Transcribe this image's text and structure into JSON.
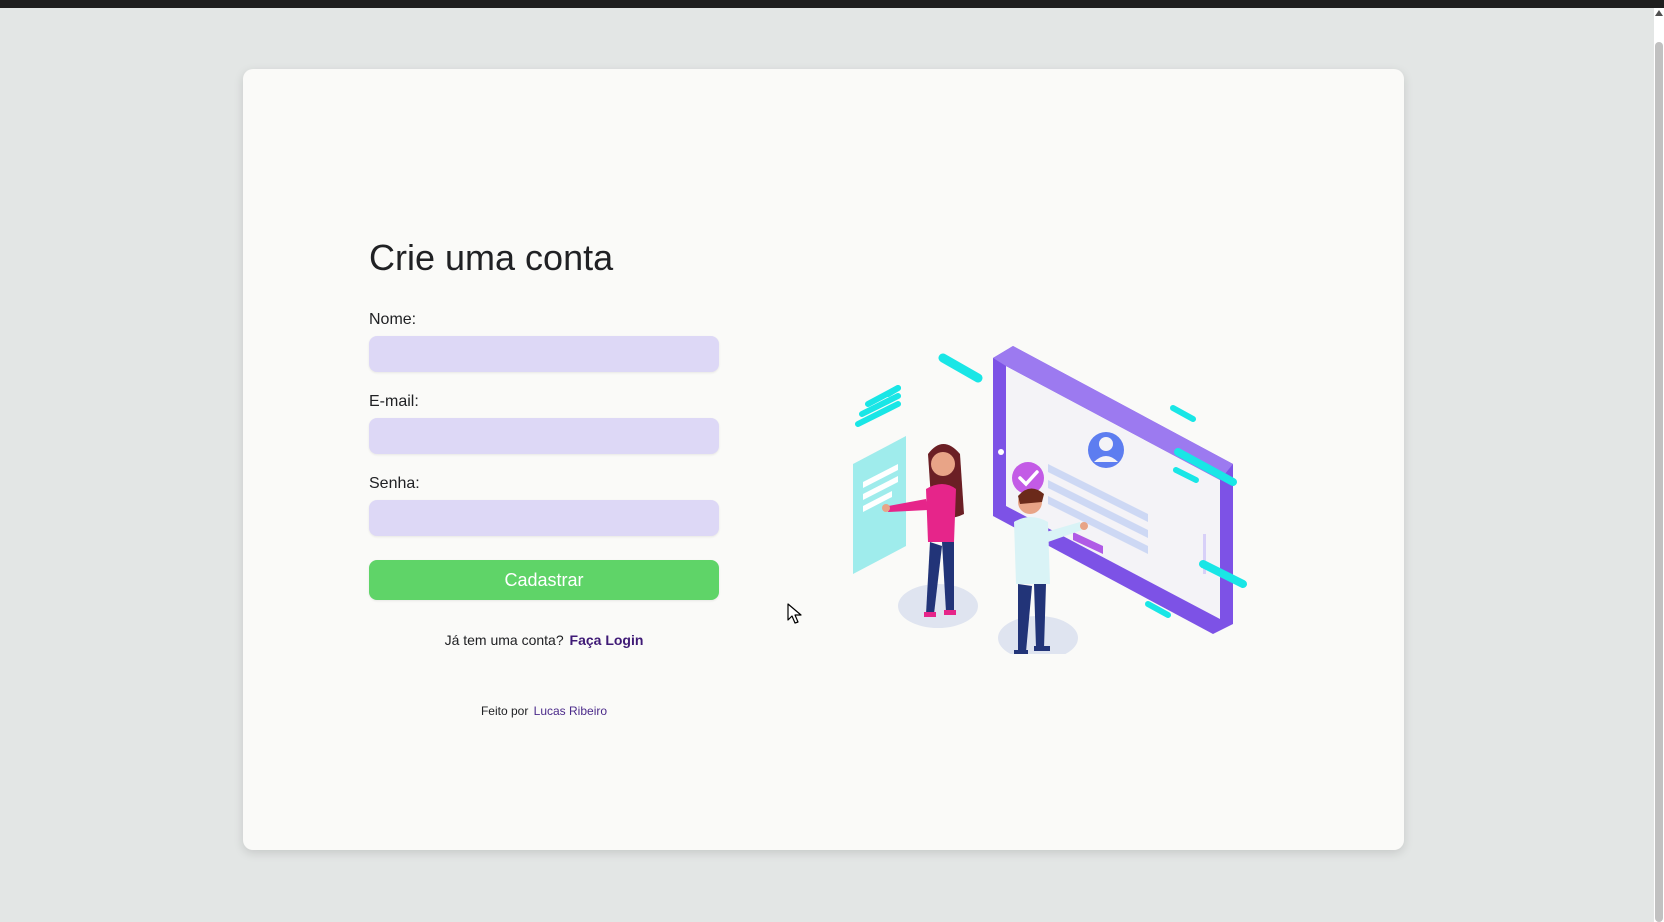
{
  "page": {
    "title": "Crie uma conta"
  },
  "form": {
    "fields": [
      {
        "label": "Nome:",
        "value": "",
        "placeholder": ""
      },
      {
        "label": "E-mail:",
        "value": "",
        "placeholder": ""
      },
      {
        "label": "Senha:",
        "value": "",
        "placeholder": ""
      }
    ],
    "submit_label": "Cadastrar"
  },
  "login": {
    "prompt": "Já tem uma conta?",
    "link_label": "Faça Login"
  },
  "footer": {
    "prefix": "Feito por",
    "author": "Lucas Ribeiro"
  },
  "illustration": {
    "icon": "signup-illustration",
    "colors": {
      "purple": "#7d52e6",
      "cyan": "#19e6e6",
      "pink": "#e6258a",
      "navy": "#223478"
    }
  },
  "colors": {
    "background": "#e3e6e5",
    "card": "#fafaf8",
    "input": "#ddd8f6",
    "button": "#5fd468",
    "link": "#3f1a76"
  }
}
